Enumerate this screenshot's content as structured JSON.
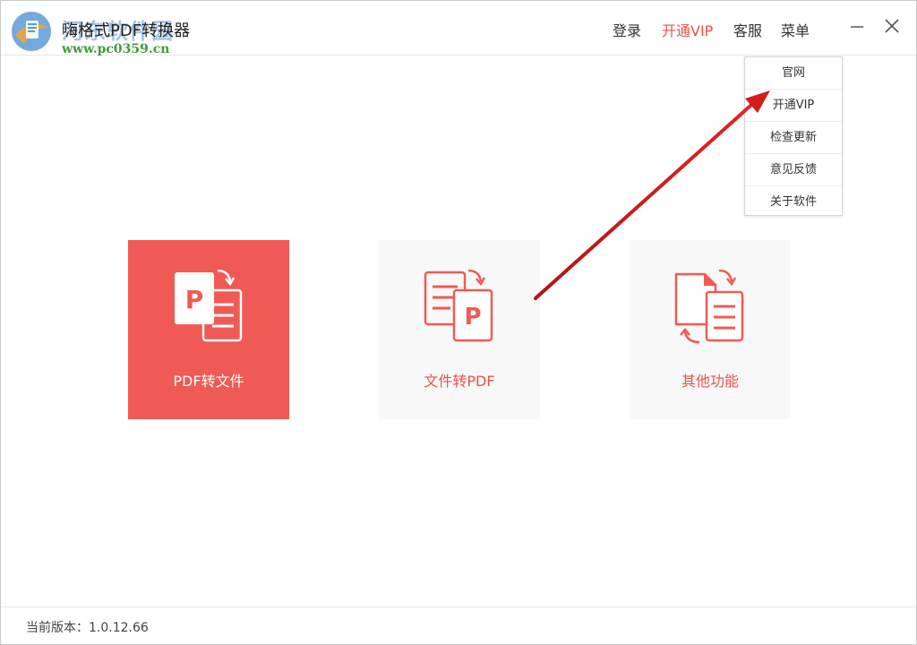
{
  "titlebar": {
    "app_title": "嗨格式PDF转换器",
    "watermark_title": "河东软件园",
    "watermark_url": "www.pc0359.cn",
    "nav": {
      "login": "登录",
      "vip": "开通VIP",
      "service": "客服",
      "menu": "菜单"
    }
  },
  "menu": {
    "items": [
      "官网",
      "开通VIP",
      "检查更新",
      "意见反馈",
      "关于软件"
    ]
  },
  "tiles": [
    {
      "label": "PDF转文件",
      "icon": "pdf-to-file-icon",
      "active": true
    },
    {
      "label": "文件转PDF",
      "icon": "file-to-pdf-icon",
      "active": false
    },
    {
      "label": "其他功能",
      "icon": "other-functions-icon",
      "active": false
    }
  ],
  "footer": {
    "version": "当前版本：1.0.12.66"
  },
  "colors": {
    "accent": "#f05a55",
    "vip": "#e8504f",
    "tile_bg": "#f8f8f8",
    "annotation_arrow": "#d11a1a"
  }
}
